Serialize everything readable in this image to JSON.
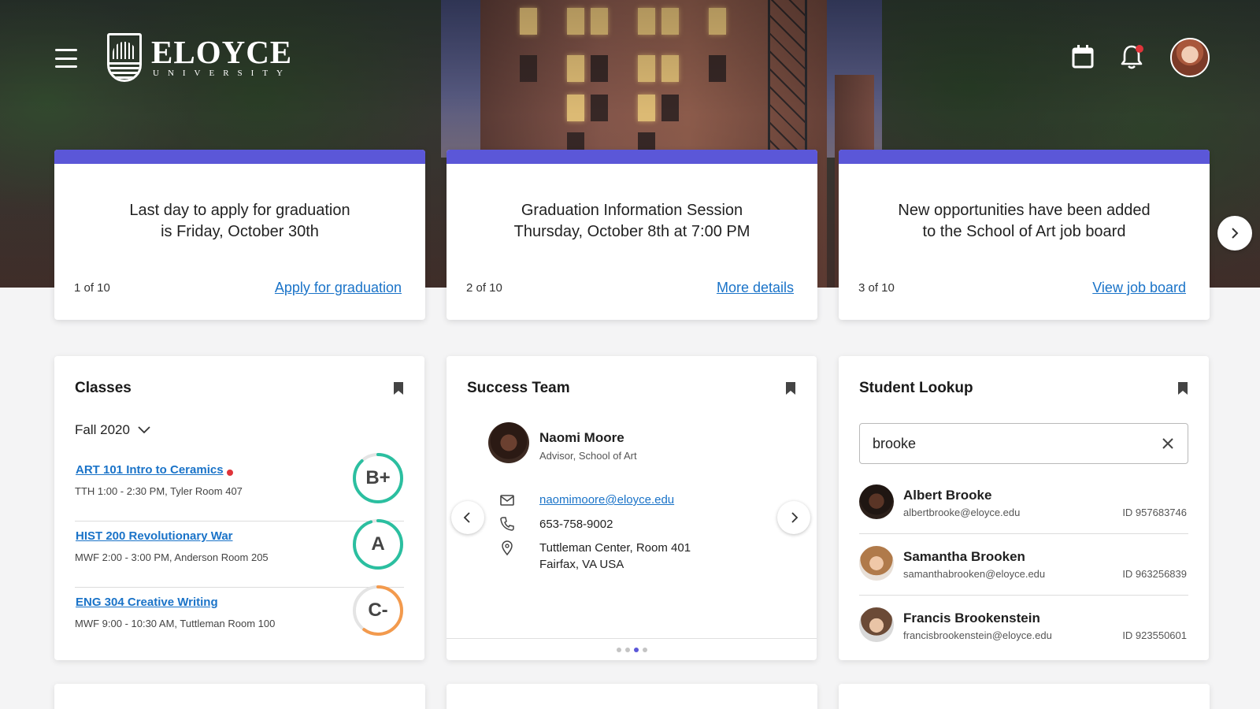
{
  "header": {
    "logo_name": "ELOYCE",
    "logo_sub": "UNIVERSITY",
    "icons": [
      "menu-icon",
      "calendar-icon",
      "bell-icon",
      "avatar"
    ]
  },
  "announcements": [
    {
      "line1": "Last day to apply for graduation",
      "line2": "is Friday, October 30th",
      "count": "1 of 10",
      "link": "Apply for graduation"
    },
    {
      "line1": "Graduation Information Session",
      "line2": "Thursday, October 8th at 7:00 PM",
      "count": "2 of 10",
      "link": "More details"
    },
    {
      "line1": "New opportunities have been added",
      "line2": "to the School of Art job board",
      "count": "3 of 10",
      "link": "View job board"
    }
  ],
  "classes": {
    "title": "Classes",
    "term": "Fall 2020",
    "items": [
      {
        "name": "ART 101 Intro to Ceramics",
        "schedule": "TTH 1:00 - 2:30 PM, Tyler Room 407",
        "grade": "B+",
        "grade_color": "#2bbfa0",
        "grade_fraction": 0.88,
        "alert": true
      },
      {
        "name": "HIST 200 Revolutionary War",
        "schedule": "MWF 2:00 - 3:00 PM, Anderson Room 205",
        "grade": "A",
        "grade_color": "#2bbfa0",
        "grade_fraction": 0.95,
        "alert": false
      },
      {
        "name": "ENG 304 Creative Writing",
        "schedule": "MWF 9:00 - 10:30 AM, Tuttleman Room 100",
        "grade": "C-",
        "grade_color": "#f39a4d",
        "grade_fraction": 0.6,
        "alert": false
      }
    ]
  },
  "success_team": {
    "title": "Success Team",
    "name": "Naomi Moore",
    "role": "Advisor, School of Art",
    "email": "naomimoore@eloyce.edu",
    "phone": "653-758-9002",
    "address_line1": "Tuttleman Center, Room 401",
    "address_line2": "Fairfax, VA USA",
    "page_count": 4,
    "active_page": 3
  },
  "student_lookup": {
    "title": "Student Lookup",
    "query": "brooke",
    "results": [
      {
        "name": "Albert Brooke",
        "email": "albertbrooke@eloyce.edu",
        "id": "ID 957683746"
      },
      {
        "name": "Samantha Brooken",
        "email": "samanthabrooken@eloyce.edu",
        "id": "ID 963256839"
      },
      {
        "name": "Francis Brookenstein",
        "email": "francisbrookenstein@eloyce.edu",
        "id": "ID 923550601"
      }
    ]
  },
  "colors": {
    "accent": "#5b57d8",
    "link": "#1a73c8",
    "alert": "#e0343a",
    "grade_good": "#2bbfa0",
    "grade_warn": "#f39a4d"
  }
}
